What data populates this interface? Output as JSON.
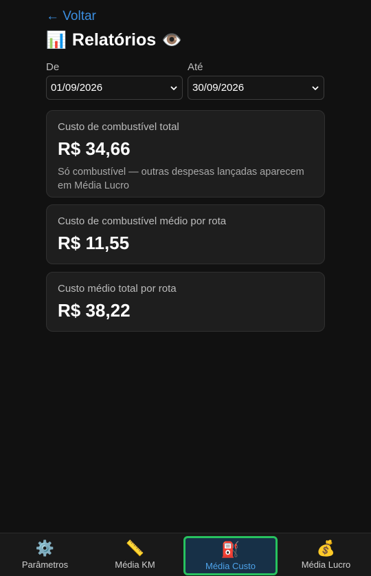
{
  "header": {
    "back_label": "← Voltar",
    "title": "Relatórios",
    "title_icon": "📊",
    "visibility_icon": "👁️"
  },
  "filters": {
    "from_label": "De",
    "from_value": "01/09/2026",
    "to_label": "Até",
    "to_value": "30/09/2026"
  },
  "cards": [
    {
      "label": "Custo de combustível total",
      "amount": "R$ 34,66",
      "note": "Só combustível — outras despesas lançadas aparecem em Média Lucro"
    },
    {
      "label": "Custo de combustível médio por rota",
      "amount": "R$ 11,55"
    },
    {
      "label": "Custo médio total por rota",
      "amount": "R$ 38,22"
    }
  ],
  "nav": [
    {
      "label": "Parâmetros",
      "icon": "⚙️"
    },
    {
      "label": "Média KM",
      "icon": "📏"
    },
    {
      "label": "Média Custo",
      "icon": "⛽"
    },
    {
      "label": "Média Lucro",
      "icon": "💰"
    }
  ],
  "colors": {
    "background": "#111111",
    "accent": "#3b8ee0",
    "active_border": "#27c25f",
    "active_bg": "#173047"
  }
}
